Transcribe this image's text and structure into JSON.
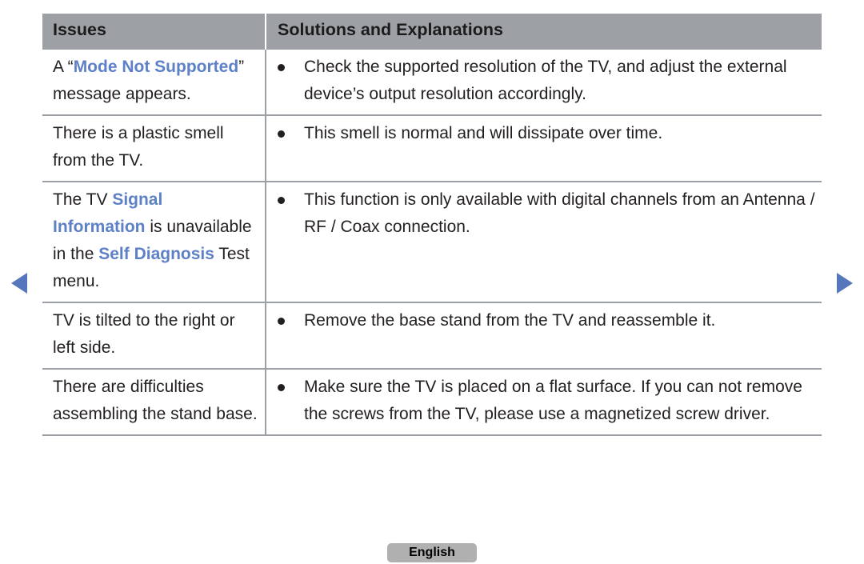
{
  "page": {
    "language_chip": "English"
  },
  "nav": {
    "prev_icon": "triangle-left-icon",
    "next_icon": "triangle-right-icon",
    "accent_color": "#5777bc"
  },
  "table": {
    "headers": {
      "issues": "Issues",
      "solutions": "Solutions and Explanations"
    },
    "header_bg": "#9da0a5",
    "highlight_color": "#5e80c6",
    "rule_color": "#9aa0a6",
    "rows": [
      {
        "issue_parts": [
          {
            "text": "A “",
            "highlight": false
          },
          {
            "text": "Mode Not Supported",
            "highlight": true
          },
          {
            "text": "” message appears.",
            "highlight": false
          }
        ],
        "issue_plain": "A “Mode Not Supported” message appears.",
        "solutions": [
          "Check the supported resolution of the TV, and adjust the external device’s output resolution accordingly."
        ]
      },
      {
        "issue_parts": [
          {
            "text": "There is a plastic smell from the TV.",
            "highlight": false
          }
        ],
        "issue_plain": "There is a plastic smell from the TV.",
        "solutions": [
          "This smell is normal and will dissipate over time."
        ]
      },
      {
        "issue_parts": [
          {
            "text": "The TV ",
            "highlight": false
          },
          {
            "text": "Signal Information",
            "highlight": true
          },
          {
            "text": " is unavailable in the ",
            "highlight": false
          },
          {
            "text": "Self Diagnosis",
            "highlight": true
          },
          {
            "text": " Test menu.",
            "highlight": false
          }
        ],
        "issue_plain": "The TV Signal Information is unavailable in the Self Diagnosis Test menu.",
        "solutions": [
          "This function is only available with digital channels from an Antenna / RF / Coax connection."
        ]
      },
      {
        "issue_parts": [
          {
            "text": "TV is tilted to the right or left side.",
            "highlight": false
          }
        ],
        "issue_plain": "TV is tilted to the right or left side.",
        "solutions": [
          "Remove the base stand from the TV and reassemble it."
        ]
      },
      {
        "issue_parts": [
          {
            "text": "There are difficulties assembling the stand base.",
            "highlight": false
          }
        ],
        "issue_plain": "There are difficulties assembling the stand base.",
        "solutions": [
          "Make sure the TV is placed on a flat surface. If you can not remove the screws from the TV, please use a magnetized screw driver."
        ]
      }
    ]
  }
}
